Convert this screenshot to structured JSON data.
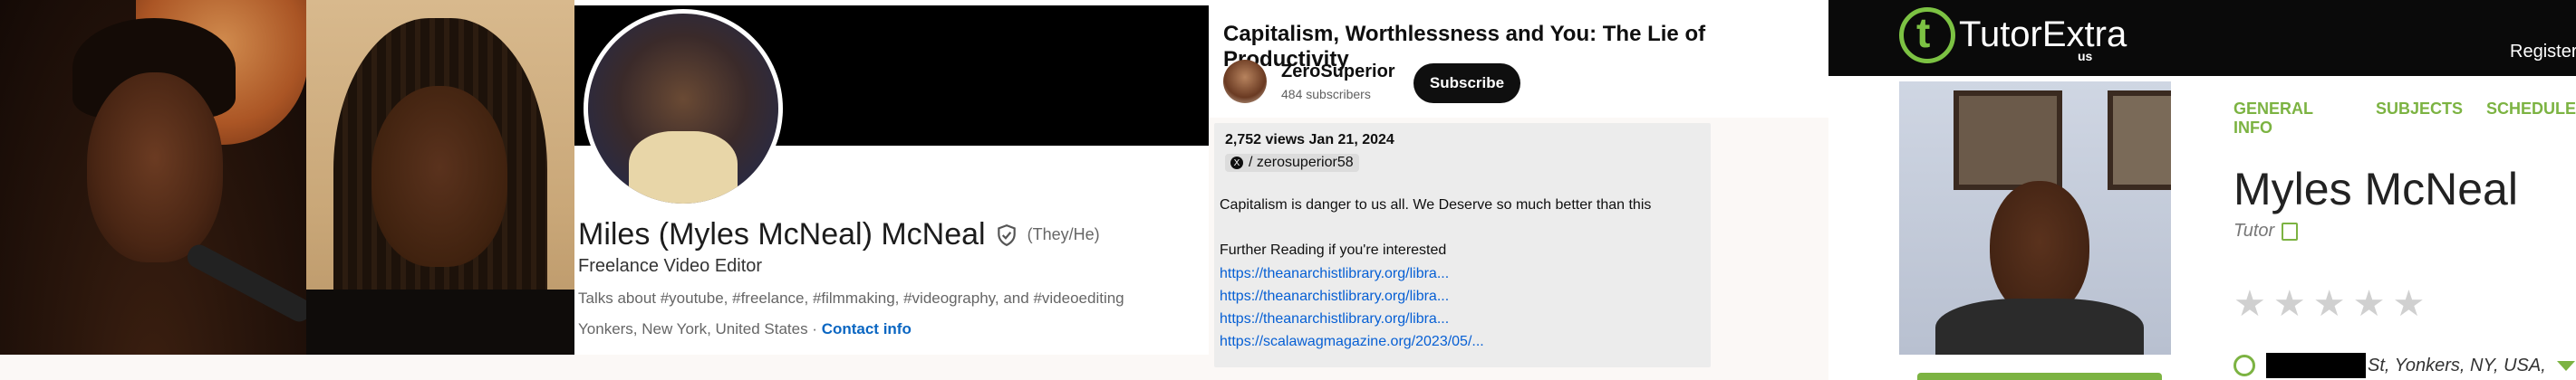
{
  "linkedin": {
    "name": "Miles (Myles McNeal) McNeal",
    "pronouns": "(They/He)",
    "headline": "Freelance Video Editor",
    "talks_about": "Talks about #youtube, #freelance, #filmmaking, #videography, and #videoediting",
    "location": "Yonkers, New York, United States",
    "separator": " · ",
    "contact_label": "Contact info"
  },
  "youtube": {
    "title": "Capitalism, Worthlessness and You: The Lie of Productivity",
    "channel_name": "ZeroSuperior",
    "subscribers": "484 subscribers",
    "subscribe_label": "Subscribe",
    "meta": "2,752 views  Jan 21, 2024",
    "handle": "/ zerosuperior58",
    "description": "Capitalism is danger to us all. We Deserve so much better than this",
    "further_reading": "Further Reading if you're interested",
    "links": [
      "https://theanarchistlibrary.org/libra...",
      "https://theanarchistlibrary.org/libra...",
      "https://theanarchistlibrary.org/libra...",
      "https://scalawagmagazine.org/2023/05/..."
    ]
  },
  "tutor": {
    "logo_text": "TutorExtra",
    "logo_sub": "us",
    "register_label": "Register",
    "nav": [
      "GENERAL INFO",
      "SUBJECTS",
      "SCHEDULE"
    ],
    "name": "Myles McNeal",
    "role": "Tutor",
    "rating_stars": 0,
    "rating_max": 5,
    "address": "St, Yonkers, NY, USA,",
    "accent_color": "#7cb342"
  }
}
